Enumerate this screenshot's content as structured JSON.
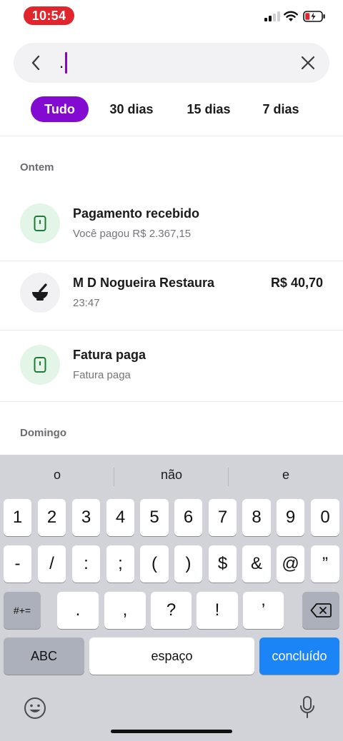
{
  "status_bar": {
    "time": "10:54"
  },
  "search": {
    "value": "."
  },
  "filters": [
    "Tudo",
    "30 dias",
    "15 dias",
    "7 dias"
  ],
  "sections": [
    {
      "label": "Ontem",
      "items": [
        {
          "title": "Pagamento recebido",
          "subtitle": "Você pagou R$ 2.367,15",
          "amount": "",
          "icon": "card-icon"
        },
        {
          "title": "M D Nogueira Restaura",
          "subtitle": "23:47",
          "amount": "R$ 40,70",
          "icon": "mortar-pestle-icon"
        },
        {
          "title": "Fatura paga",
          "subtitle": "Fatura paga",
          "amount": "",
          "icon": "card-icon"
        }
      ]
    },
    {
      "label": "Domingo",
      "items": []
    }
  ],
  "keyboard": {
    "suggestions": [
      "o",
      "não",
      "e"
    ],
    "row1": [
      "1",
      "2",
      "3",
      "4",
      "5",
      "6",
      "7",
      "8",
      "9",
      "0"
    ],
    "row2": [
      "-",
      "/",
      ":",
      ";",
      "(",
      ")",
      "$",
      "&",
      "@",
      "”"
    ],
    "row3": [
      ".",
      ",",
      "?",
      "!",
      "’"
    ],
    "shift_label": "#+=",
    "abc_label": "ABC",
    "space_label": "espaço",
    "done_label": "concluído"
  },
  "colors": {
    "accent": "#820ad1",
    "time_pill": "#e0262c",
    "done_key": "#1b84f6"
  }
}
